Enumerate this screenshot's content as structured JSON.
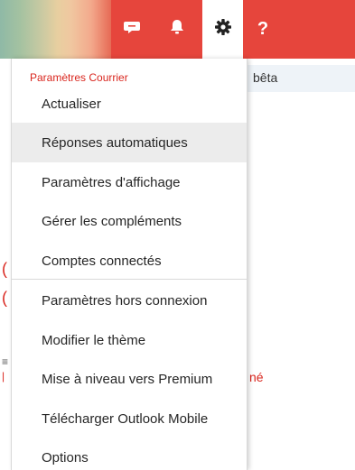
{
  "topbar": {
    "icons": {
      "chat": "chat-bubble-icon",
      "notifications": "bell-icon",
      "settings": "gear-icon",
      "help": "question-mark-icon"
    },
    "help_glyph": "?",
    "colors": {
      "red": "#e6453c",
      "selected": "#ffffff"
    }
  },
  "background": {
    "beta_label": "bêta",
    "fragment_text": "né"
  },
  "menu": {
    "header": "Paramètres Courrier",
    "items": [
      {
        "label": "Actualiser"
      },
      {
        "label": "Réponses automatiques"
      },
      {
        "label": "Paramètres d'affichage"
      },
      {
        "label": "Gérer les compléments"
      },
      {
        "label": "Comptes connectés"
      },
      {
        "label": "Paramètres hors connexion"
      },
      {
        "label": "Modifier le thème"
      },
      {
        "label": "Mise à niveau vers Premium"
      },
      {
        "label": "Télécharger Outlook Mobile"
      },
      {
        "label": "Options"
      }
    ],
    "header_color": "#d9251d"
  }
}
